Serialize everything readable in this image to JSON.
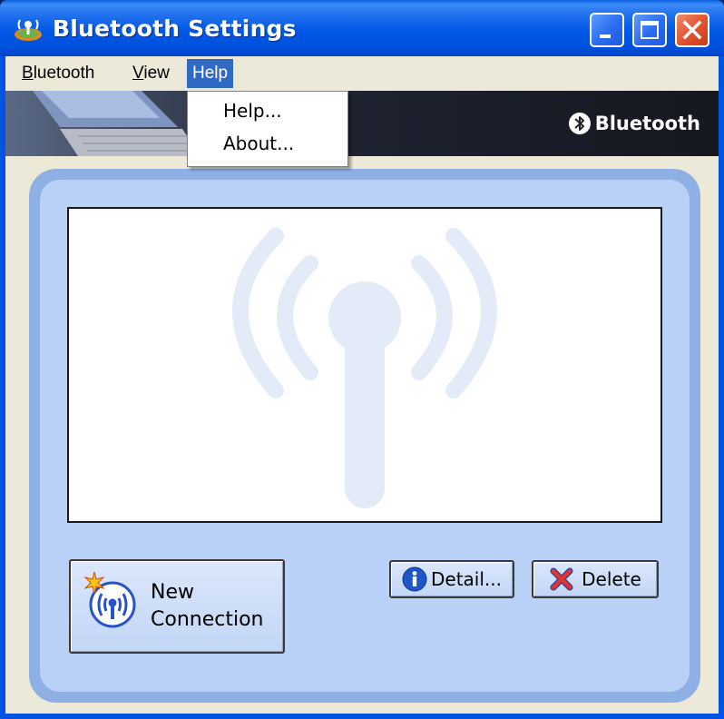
{
  "window": {
    "title": "Bluetooth Settings"
  },
  "menu": {
    "items": [
      {
        "label_prefix": "",
        "accel": "B",
        "label_rest": "luetooth"
      },
      {
        "label_prefix": "",
        "accel": "V",
        "label_rest": "iew"
      },
      {
        "label_prefix": "",
        "accel": "",
        "label_rest": "Help"
      }
    ]
  },
  "help_menu": {
    "items": [
      "Help...",
      "About..."
    ]
  },
  "banner": {
    "logo_text": "Bluetooth"
  },
  "buttons": {
    "new_connection_line1": "New",
    "new_connection_line2": "Connection",
    "detail": "Detail...",
    "delete": "Delete"
  },
  "icons": {
    "title": "bluetooth-antenna-icon",
    "minimize": "minimize-icon",
    "maximize": "maximize-icon",
    "close": "close-icon",
    "banner_logo": "bluetooth-logo-icon",
    "new_connection": "new-connection-antenna-icon",
    "detail": "info-icon",
    "delete": "red-x-icon"
  },
  "colors": {
    "titlebar": "#0058e6",
    "menu_highlight": "#316ac5",
    "panel_outer": "#8eb0e4",
    "panel_inner": "#b9d1f6",
    "watermark": "#e3ebf8"
  }
}
